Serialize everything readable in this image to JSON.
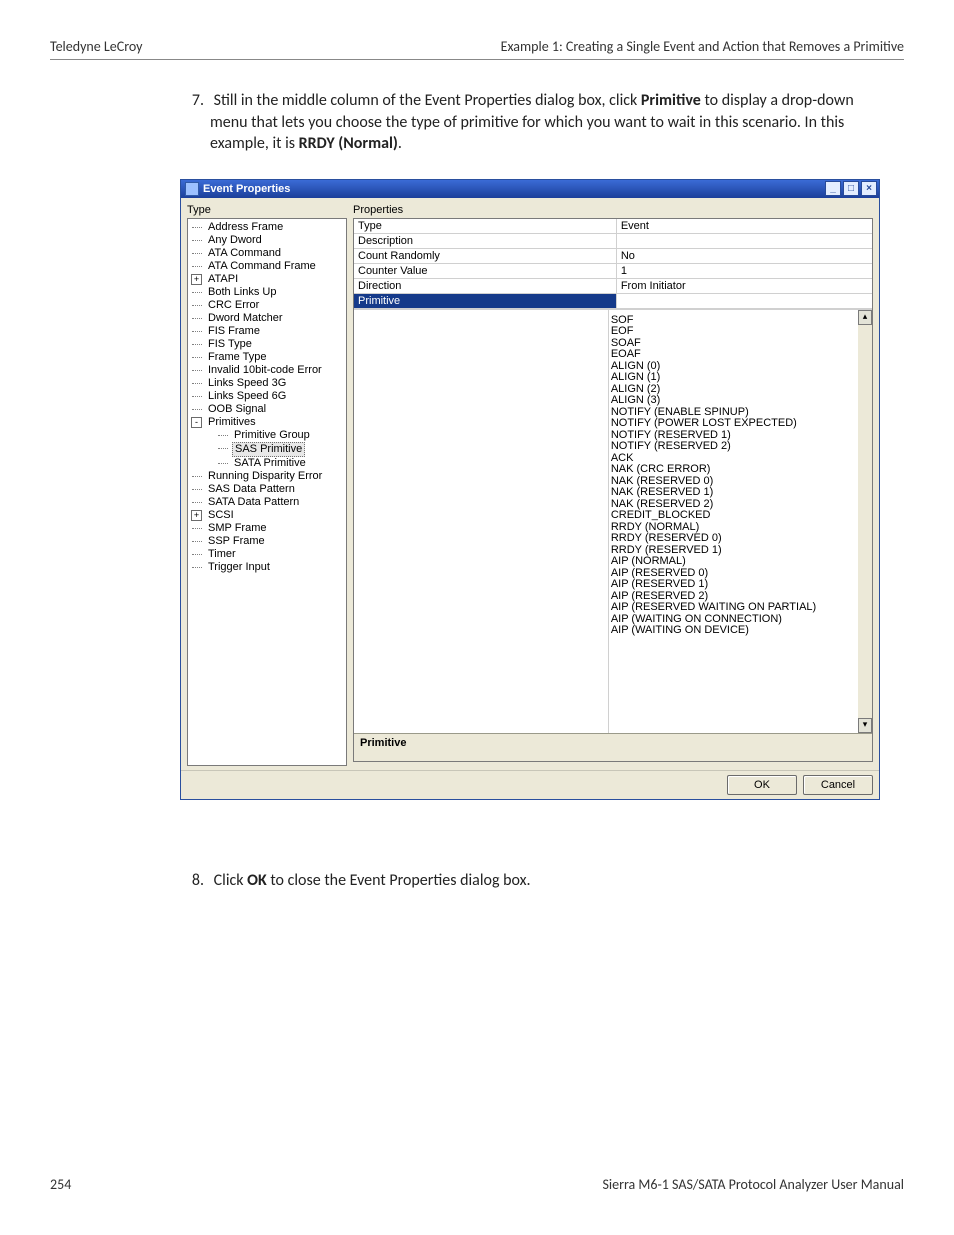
{
  "header": {
    "left": "Teledyne LeCroy",
    "right": "Example 1: Creating a Single Event and Action that Removes a Primitive"
  },
  "step7": {
    "num": "7.",
    "pre": "Still in the middle column of the Event Properties dialog box, click ",
    "bold1": "Primitive",
    "mid": " to display a drop-down menu that lets you choose the type of primitive for which you want to wait in this scenario. In this example, it is ",
    "bold2": "RRDY (Normal)",
    "post": "."
  },
  "dialog": {
    "title": "Event Properties",
    "min": "_",
    "max": "□",
    "close": "×",
    "type_label": "Type",
    "prop_label": "Properties",
    "tree": {
      "address_frame": "Address Frame",
      "any_dword": "Any Dword",
      "ata_command": "ATA Command",
      "ata_command_frame": "ATA Command Frame",
      "atapi": "ATAPI",
      "both_links_up": "Both Links Up",
      "crc_error": "CRC Error",
      "dword_matcher": "Dword Matcher",
      "fis_frame": "FIS Frame",
      "fis_type": "FIS Type",
      "frame_type": "Frame Type",
      "invalid_10bit": "Invalid 10bit-code Error",
      "links_speed_3g": "Links Speed 3G",
      "links_speed_6g": "Links Speed 6G",
      "oob_signal": "OOB Signal",
      "primitives": "Primitives",
      "primitive_group": "Primitive Group",
      "sas_primitive": "SAS Primitive",
      "sata_primitive": "SATA Primitive",
      "running_disparity": "Running Disparity Error",
      "sas_data_pattern": "SAS Data Pattern",
      "sata_data_pattern": "SATA Data Pattern",
      "scsi": "SCSI",
      "smp_frame": "SMP Frame",
      "ssp_frame": "SSP Frame",
      "timer": "Timer",
      "trigger_input": "Trigger Input"
    },
    "props": {
      "type_l": "Type",
      "type_v": "Event",
      "desc_l": "Description",
      "desc_v": "",
      "countr_l": "Count Randomly",
      "countr_v": "No",
      "countv_l": "Counter Value",
      "countv_v": "1",
      "dir_l": "Direction",
      "dir_v": "From Initiator",
      "prim_l": "Primitive",
      "prim_v": ""
    },
    "dropdown": [
      "SOF",
      "EOF",
      "SOAF",
      "EOAF",
      "ALIGN (0)",
      "ALIGN (1)",
      "ALIGN (2)",
      "ALIGN (3)",
      "NOTIFY (ENABLE SPINUP)",
      "NOTIFY (POWER LOST EXPECTED)",
      "NOTIFY (RESERVED 1)",
      "NOTIFY (RESERVED 2)",
      "ACK",
      "NAK (CRC ERROR)",
      "NAK (RESERVED 0)",
      "NAK (RESERVED 1)",
      "NAK (RESERVED 2)",
      "CREDIT_BLOCKED",
      "RRDY (NORMAL)",
      "RRDY (RESERVED 0)",
      "RRDY (RESERVED 1)",
      "AIP (NORMAL)",
      "AIP (RESERVED 0)",
      "AIP (RESERVED 1)",
      "AIP (RESERVED 2)",
      "AIP (RESERVED WAITING ON PARTIAL)",
      "AIP (WAITING ON CONNECTION)",
      "AIP (WAITING ON DEVICE)"
    ],
    "hint": "Primitive",
    "ok": "OK",
    "cancel": "Cancel"
  },
  "step8": {
    "num": "8.",
    "pre": "Click ",
    "bold1": "OK",
    "post": " to close the Event Properties dialog box."
  },
  "footer": {
    "page": "254",
    "manual": "Sierra M6-1 SAS/SATA Protocol Analyzer User Manual"
  }
}
